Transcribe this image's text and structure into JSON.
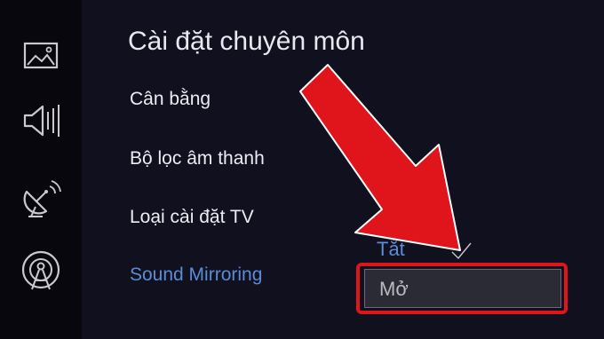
{
  "sidebar": {
    "icons": [
      {
        "name": "picture-icon"
      },
      {
        "name": "sound-icon"
      },
      {
        "name": "broadcast-icon"
      },
      {
        "name": "network-icon"
      }
    ]
  },
  "menu": {
    "title": "Cài đặt chuyên môn",
    "items": [
      {
        "label": "Cân bằng"
      },
      {
        "label": "Bộ lọc âm thanh"
      },
      {
        "label": "Loại cài đặt TV"
      },
      {
        "label": "Sound Mirroring"
      }
    ]
  },
  "dropdown": {
    "options": [
      {
        "label": "Tắt",
        "selected": true
      },
      {
        "label": "Mở",
        "selected": false
      }
    ]
  },
  "colors": {
    "background": "#10101f",
    "accent_blue": "#5b8cd6",
    "annotation_red": "#e0141b"
  }
}
